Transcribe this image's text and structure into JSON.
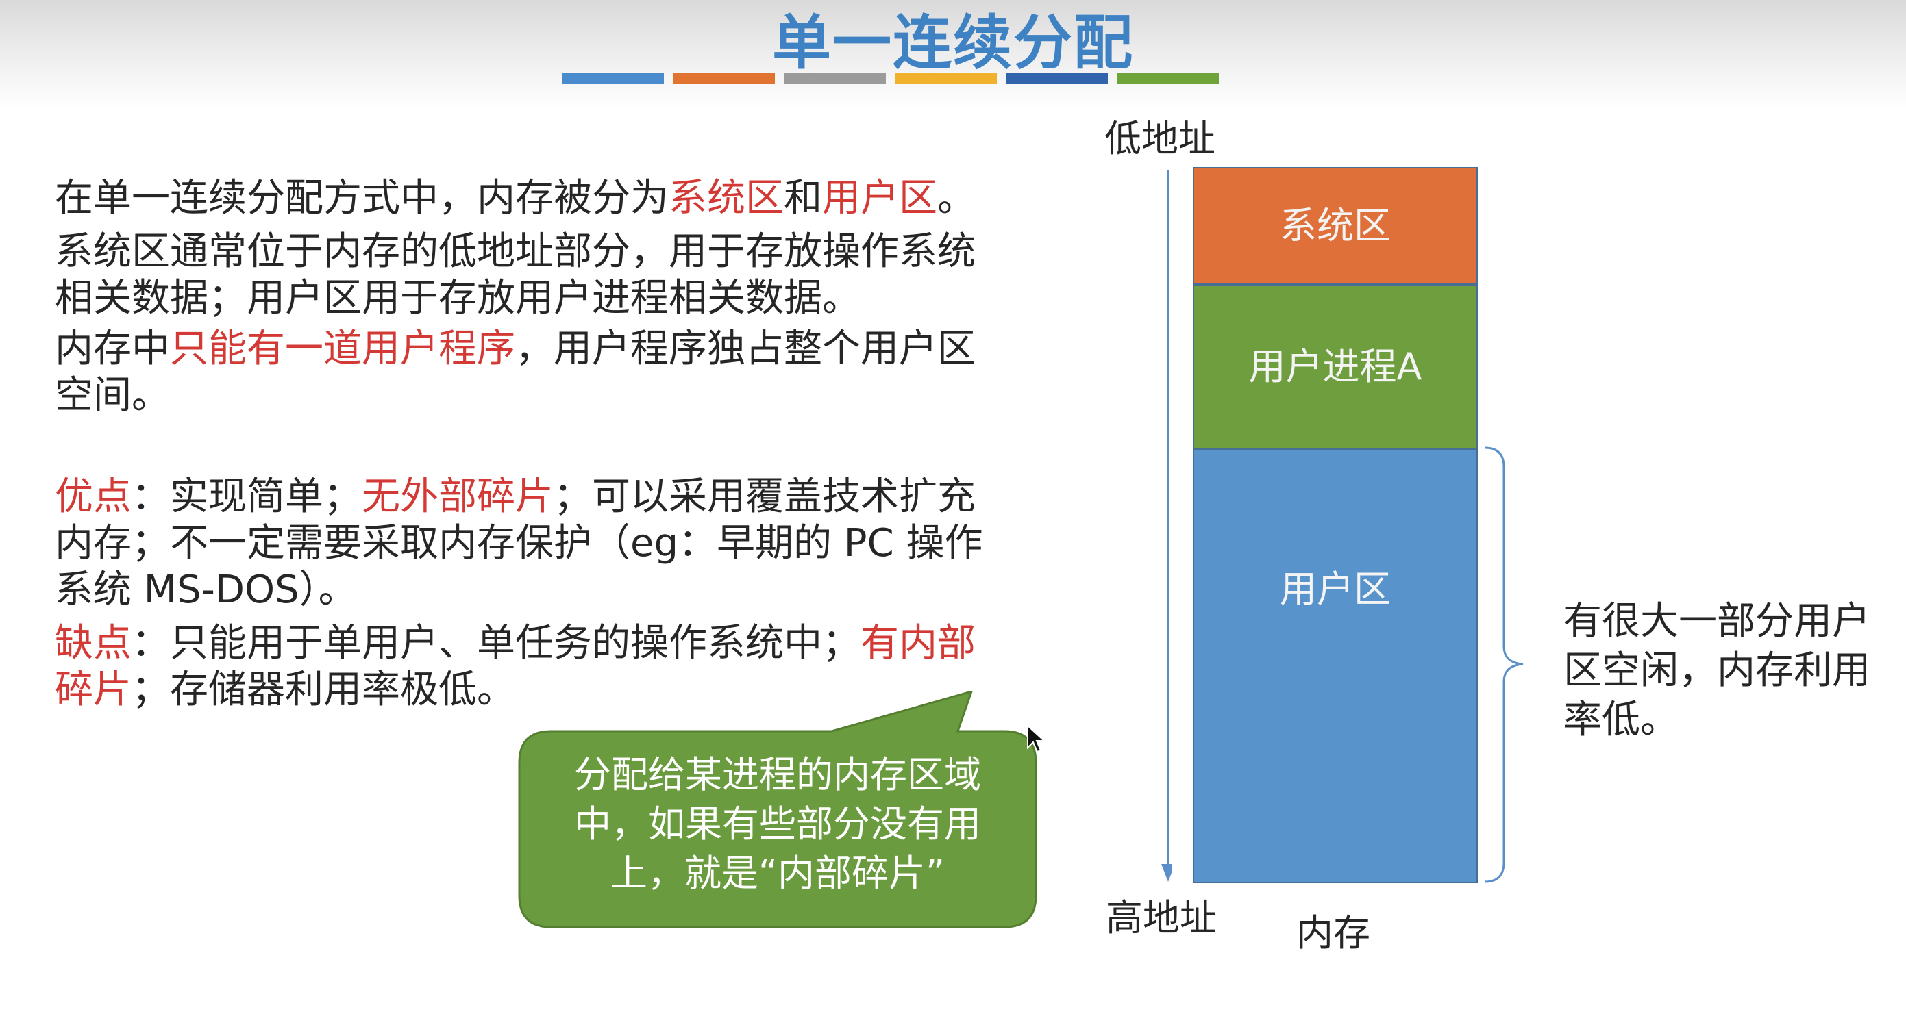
{
  "slide": {
    "title": "单一连续分配"
  },
  "accent_colors": [
    "#4a8bcd",
    "#e0732f",
    "#9b9b9b",
    "#f2b12d",
    "#3263ad",
    "#6fa43a"
  ],
  "left_text": {
    "p1_a": "在单一连续分配方式中，内存被分为",
    "p1_b": "系统区",
    "p1_c": "和",
    "p1_d": "用户区",
    "p1_e": "。",
    "p2_l1": "系统区通常位于内存的低地址部分，用于存放操作系统",
    "p2_l2": "相关数据；用户区用于存放用户进程相关数据。",
    "p3_a": "内存中",
    "p3_b": "只能有一道用户程序",
    "p3_c": "，用户程序独占整个用户区",
    "p3_l2": "空间。",
    "adv_label": "优点",
    "adv_a": "：实现简单；",
    "adv_b": "无外部碎片",
    "adv_c": "；可以采用覆盖技术扩充",
    "adv_l2": "内存；不一定需要采取内存保护（eg：早期的 PC 操作",
    "adv_l3": "系统 MS-DOS）。",
    "dis_label": "缺点",
    "dis_a": "：只能用于单用户、单任务的操作系统中；",
    "dis_b": "有内部",
    "dis_l2a": "碎片",
    "dis_l2b": "；存储器利用率极低。"
  },
  "callout": {
    "line1": "分配给某进程的内存区域",
    "line2": "中，如果有些部分没有用",
    "line3": "上，就是“内部碎片”"
  },
  "memory_diagram": {
    "low_address": "低地址",
    "high_address": "高地址",
    "caption": "内存",
    "system_area": "系统区",
    "process_a": "用户进程A",
    "user_area": "用户区",
    "colors": {
      "system": "#e0703a",
      "process": "#6e9e3d",
      "user": "#5993cb"
    },
    "note_l1": "有很大一部分用户",
    "note_l2": "区空闲，内存利用",
    "note_l3": "率低。"
  }
}
